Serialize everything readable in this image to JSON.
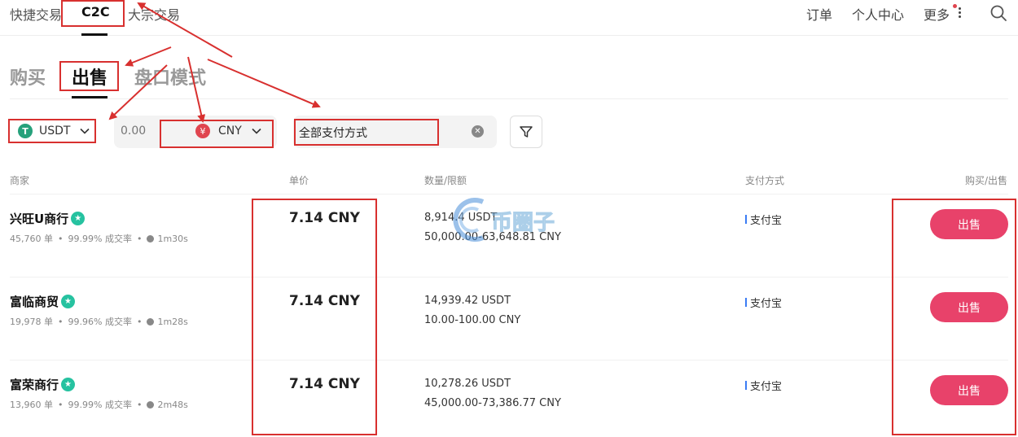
{
  "topnav": {
    "tabs": [
      "快捷交易",
      "C2C",
      "大宗交易"
    ],
    "right": [
      "订单",
      "个人中心",
      "更多"
    ]
  },
  "subtabs": [
    "购买",
    "出售",
    "盘口模式"
  ],
  "filters": {
    "coin": "USDT",
    "coin_icon": "T",
    "amount_placeholder": "0.00",
    "fiat": "CNY",
    "fiat_icon": "¥",
    "payment": "全部支付方式"
  },
  "table": {
    "headers": [
      "商家",
      "单价",
      "数量/限额",
      "支付方式",
      "购买/出售"
    ],
    "rows": [
      {
        "merchant": "兴旺U商行",
        "orders": "45,760 单",
        "rate": "99.99% 成交率",
        "time": "1m30s",
        "price": "7.14 CNY",
        "qty": "8,914.4 USDT",
        "limit": "50,000.00-63,648.81 CNY",
        "pay": "支付宝",
        "action": "出售"
      },
      {
        "merchant": "富临商贸",
        "orders": "19,978 单",
        "rate": "99.96% 成交率",
        "time": "1m28s",
        "price": "7.14 CNY",
        "qty": "14,939.42 USDT",
        "limit": "10.00-100.00 CNY",
        "pay": "支付宝",
        "action": "出售"
      },
      {
        "merchant": "富荣商行",
        "orders": "13,960 单",
        "rate": "99.99% 成交率",
        "time": "2m48s",
        "price": "7.14 CNY",
        "qty": "10,278.26 USDT",
        "limit": "45,000.00-73,386.77 CNY",
        "pay": "支付宝",
        "action": "出售"
      }
    ]
  },
  "watermark": "币圈子",
  "colors": {
    "accent": "#e8426a",
    "annotation": "#d8302f",
    "tether": "#26a17b",
    "verified": "#26c2a0"
  }
}
